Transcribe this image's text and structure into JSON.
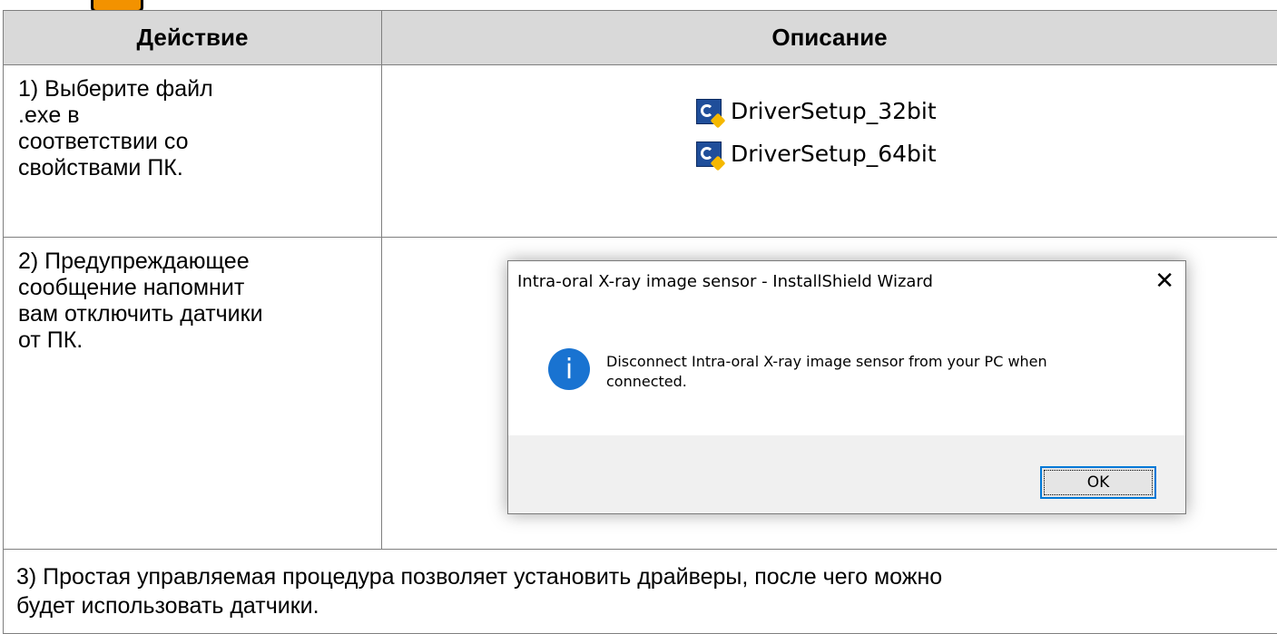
{
  "table": {
    "headers": {
      "action": "Действие",
      "description": "Описание"
    },
    "step1": {
      "lines": [
        "1) Выберите файл",
        ".exe в",
        "соответствии со",
        "свойствами ПК."
      ],
      "files": [
        {
          "name": "DriverSetup_32bit",
          "icon": "installer-icon"
        },
        {
          "name": "DriverSetup_64bit",
          "icon": "installer-icon"
        }
      ]
    },
    "step2": {
      "lines": [
        "2) Предупреждающее",
        "сообщение напомнит",
        "вам отключить датчики",
        "от ПК."
      ],
      "dialog": {
        "title": "Intra-oral X-ray image sensor - InstallShield Wizard",
        "close_glyph": "✕",
        "icon": "info-icon",
        "icon_glyph": "i",
        "message_line1": "Disconnect Intra-oral X-ray image sensor from your PC when",
        "message_line2": "connected.",
        "ok_label": "OK"
      }
    },
    "step3": {
      "line1": "3) Простая управляемая процедура позволяет установить драйверы, после чего можно",
      "line2": "будет использовать датчики."
    }
  },
  "colors": {
    "header_bg": "#d9d9d9",
    "warning_orange": "#f39200",
    "info_blue": "#1973d1",
    "button_focus": "#0078d7"
  }
}
